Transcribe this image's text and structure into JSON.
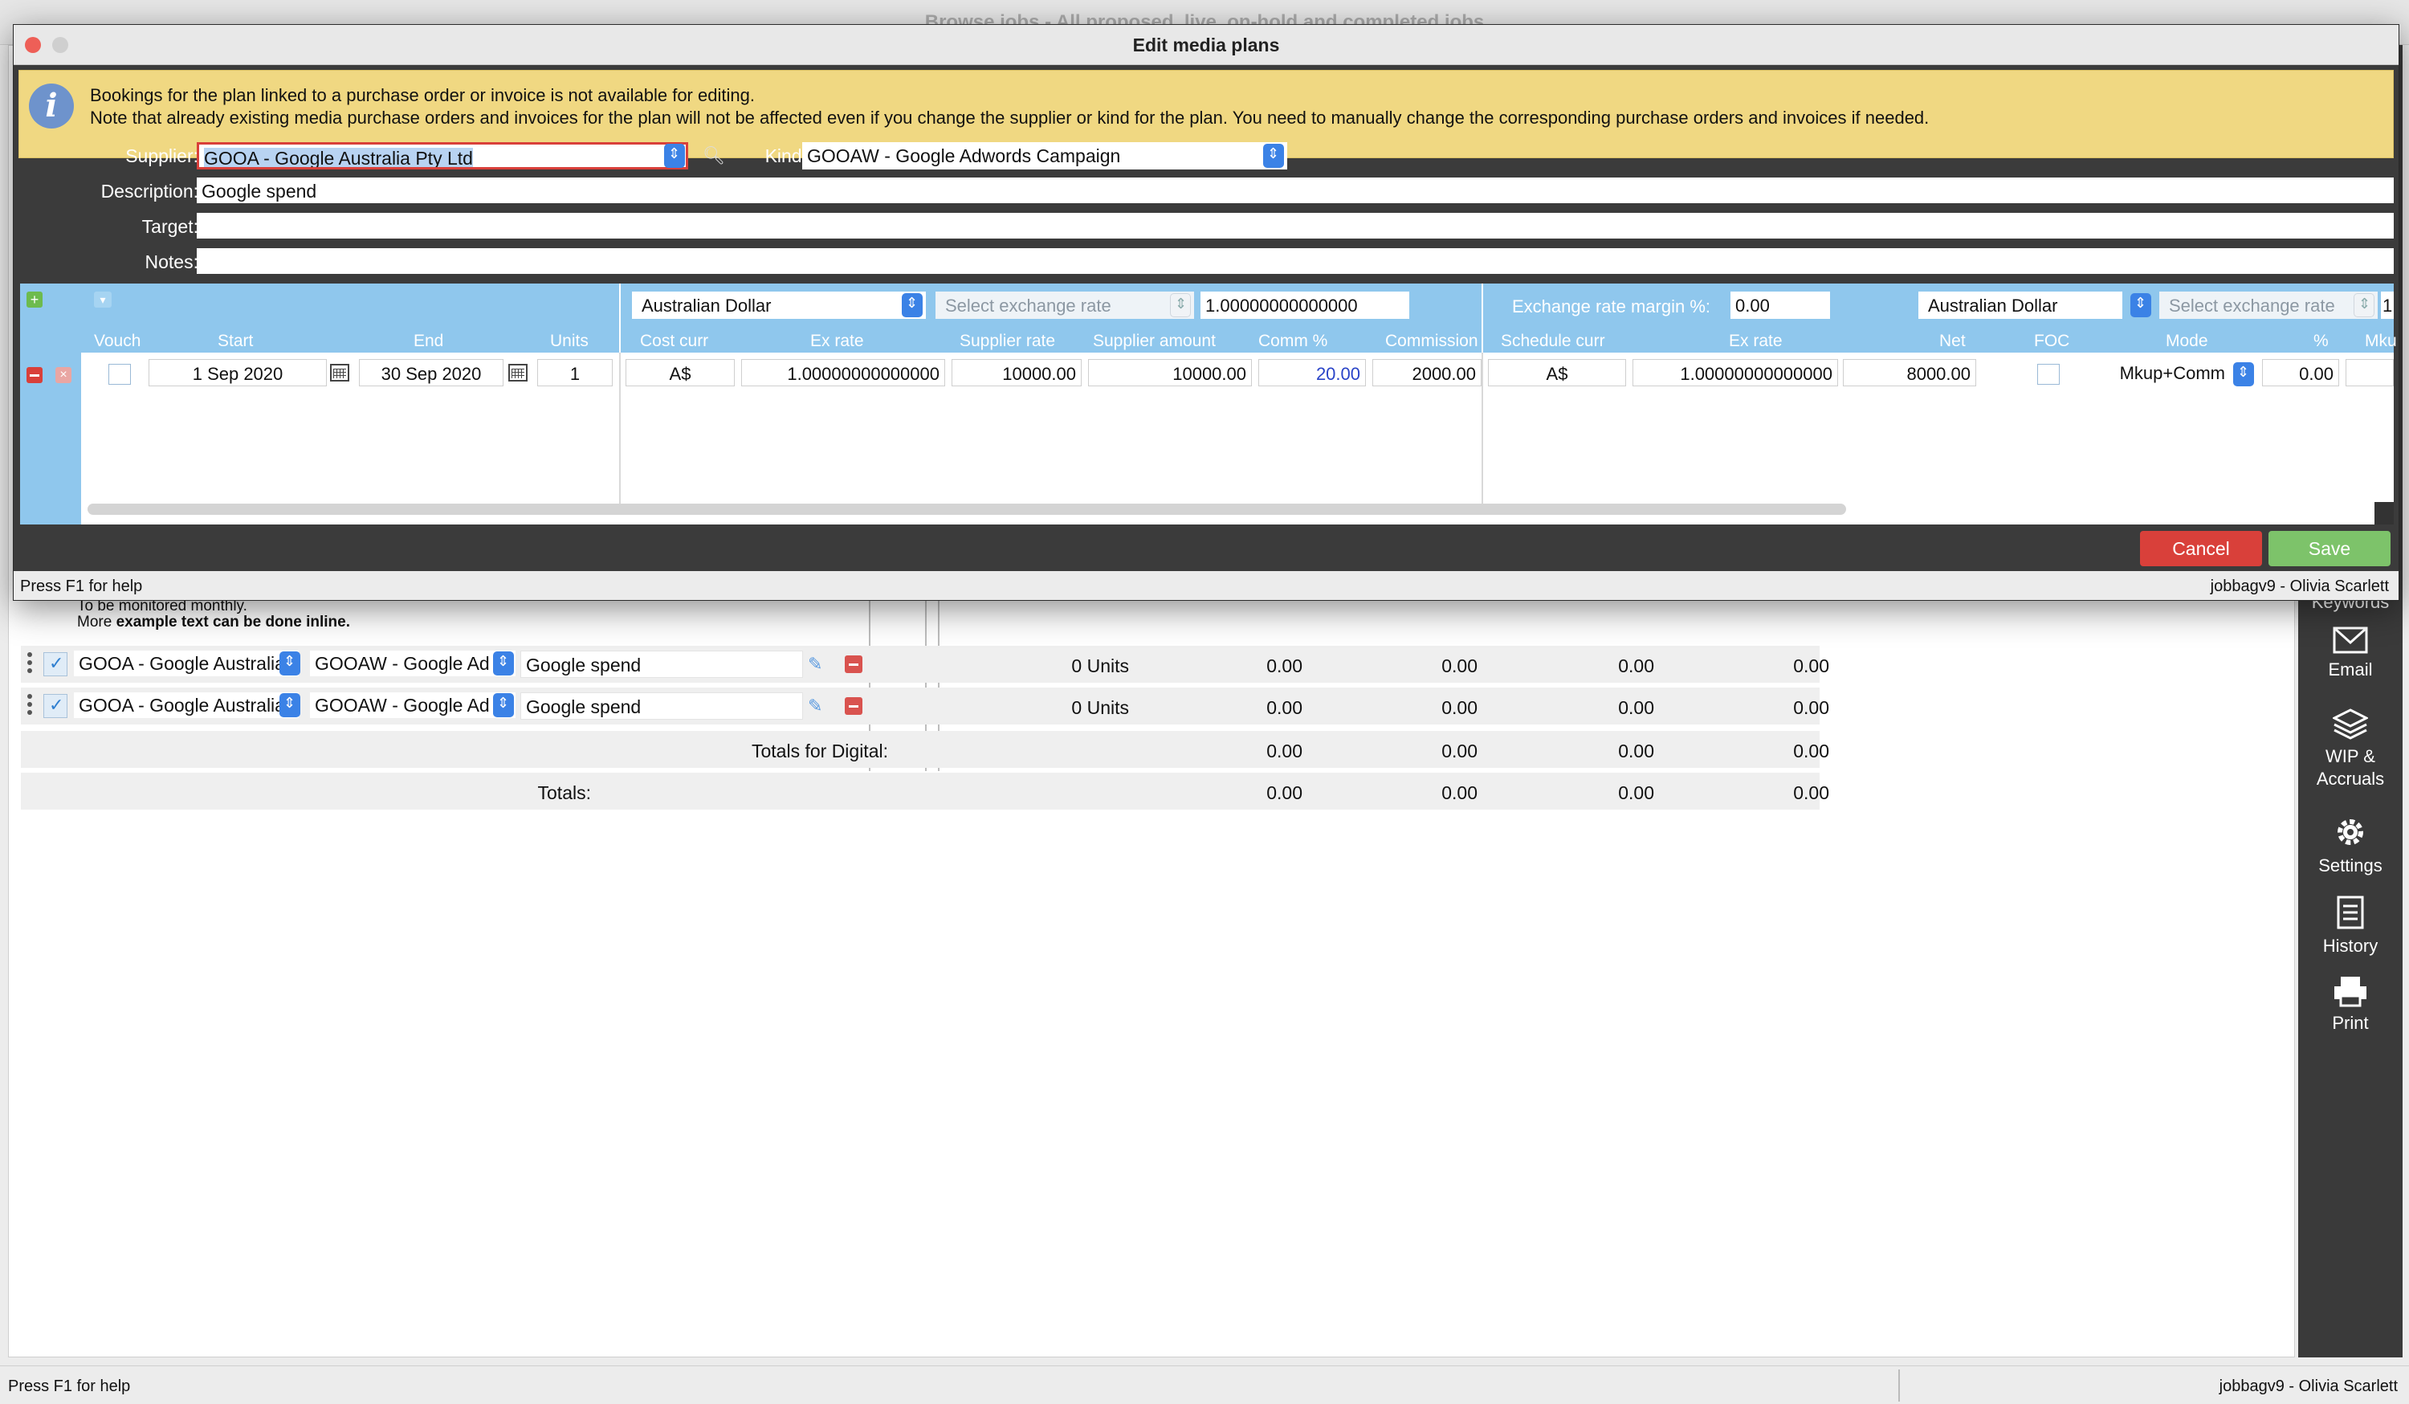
{
  "background": {
    "window_title": "Browse jobs - All proposed, live, on-hold and completed jobs",
    "note_line1": "To be monitored monthly.",
    "note_line2_prefix": "More ",
    "note_line2_bold": "example text can be done inline.",
    "rows": [
      {
        "supplier": "GOOA - Google Australia",
        "kind": "GOOAW - Google Ad",
        "description": "Google spend",
        "units": "0 Units",
        "v1": "0.00",
        "v2": "0.00",
        "v3": "0.00",
        "v4": "0.00"
      },
      {
        "supplier": "GOOA - Google Australia",
        "kind": "GOOAW - Google Ad",
        "description": "Google spend",
        "units": "0 Units",
        "v1": "0.00",
        "v2": "0.00",
        "v3": "0.00",
        "v4": "0.00"
      }
    ],
    "totals_digital": {
      "label": "Totals for  Digital:",
      "v1": "0.00",
      "v2": "0.00",
      "v3": "0.00",
      "v4": "0.00"
    },
    "totals": {
      "label": "Totals:",
      "v1": "0.00",
      "v2": "0.00",
      "v3": "0.00",
      "v4": "0.00"
    },
    "sidebar": {
      "keywords": "Keywords",
      "email": "Email",
      "wip_line1": "WIP &",
      "wip_line2": "Accruals",
      "settings": "Settings",
      "history": "History",
      "print": "Print"
    },
    "status_left": "Press F1 for help",
    "status_right": "jobbagv9 - Olivia Scarlett"
  },
  "dialog": {
    "title": "Edit media plans",
    "warning_line1": "Bookings for the plan linked to a purchase order or invoice is not available for editing.",
    "warning_line2": "Note that already existing media purchase orders and invoices for the plan will not be affected even if you change the supplier or kind for the plan.  You need to manually change the corresponding purchase orders and invoices if needed.",
    "supplier_label": "Supplier:",
    "supplier_value": "GOOA - Google Australia Pty Ltd",
    "kind_label": "Kind:",
    "kind_value": "GOOAW -  Google Adwords Campaign",
    "description_label": "Description:",
    "description_value": "Google spend",
    "target_label": "Target:",
    "target_value": "",
    "notes_label": "Notes:",
    "notes_value": "",
    "grid": {
      "cost_currency": "Australian Dollar",
      "cost_exchange_placeholder": "Select exchange rate",
      "cost_exchange_value": "1.00000000000000",
      "margin_label": "Exchange rate margin %:",
      "margin_value": "0.00",
      "schedule_currency": "Australian Dollar",
      "schedule_exchange_placeholder": "Select exchange rate",
      "schedule_exchange_value": "1",
      "headers": {
        "vouch": "Vouch",
        "start": "Start",
        "end": "End",
        "units": "Units",
        "cost_curr": "Cost curr",
        "ex_rate": "Ex rate",
        "supplier_rate": "Supplier rate",
        "supplier_amount": "Supplier amount",
        "comm_pct": "Comm %",
        "commission": "Commission",
        "schedule_curr": "Schedule curr",
        "ex_rate2": "Ex rate",
        "net": "Net",
        "foc": "FOC",
        "mode": "Mode",
        "pct": "%",
        "mk": "Mku"
      },
      "row": {
        "start": "1 Sep 2020",
        "end": "30 Sep 2020",
        "units": "1",
        "cost_curr": "A$",
        "ex_rate": "1.00000000000000",
        "supplier_rate": "10000.00",
        "supplier_amount": "10000.00",
        "comm_pct": "20.00",
        "commission": "2000.00",
        "schedule_curr": "A$",
        "ex_rate2": "1.00000000000000",
        "net": "8000.00",
        "mode": "Mkup+Comm",
        "pct": "0.00"
      }
    },
    "cancel_label": "Cancel",
    "save_label": "Save",
    "status_left": "Press F1 for help",
    "status_right": "jobbagv9 - Olivia Scarlett"
  },
  "colors": {
    "accent": "#3b82e6",
    "warning_bg": "#f0d882",
    "grid_header": "#8fc7ed",
    "cancel": "#d9403a",
    "save": "#7dc36a",
    "comm_text": "#2a44c8"
  }
}
